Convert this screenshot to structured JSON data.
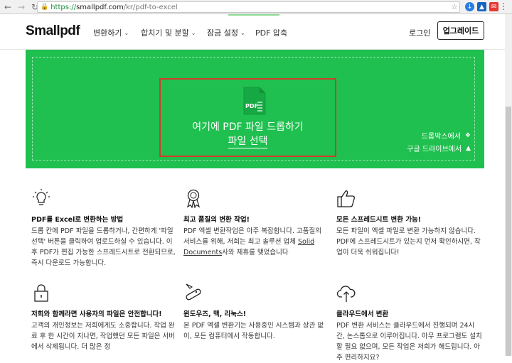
{
  "browser": {
    "url_scheme": "https://",
    "url_host": "smallpdf.com",
    "url_path": "/kr/pdf-to-excel"
  },
  "header": {
    "logo": "Smallpdf",
    "menu": [
      "변환하기",
      "합치기 및 분할",
      "잠금 설정",
      "PDF 압축"
    ],
    "login": "로그인",
    "upgrade": "업그레이드"
  },
  "dropzone": {
    "pdf_label": "PDF",
    "drop_text": "여기에 PDF 파일 드롭하기",
    "choose_file": "파일 선택",
    "dropbox": "드롭박스에서",
    "gdrive": "구글 드라이브에서"
  },
  "features": [
    {
      "icon": "lightbulb-icon",
      "title": "PDF를 Excel로 변환하는 방법",
      "body": "드롭 칸에 PDF 파일을 드롭하거나, 간편하게 '파일 선택' 버튼을 클릭하여 업로드하실 수 있습니다. 이후 PDF가 편집 가능한 스프레드시트로 전환되므로, 즉시 다운로드 가능합니다."
    },
    {
      "icon": "award-icon",
      "title": "최고 품질의 변환 작업!",
      "body_pre": "PDF 엑셀 변환작업은 아주 복잡합니다. 고품질의 서비스를 위해, 저희는 최고 솔루션 업체 ",
      "body_link": "Solid Documents",
      "body_post": "사와 제휴를 맺었습니다"
    },
    {
      "icon": "thumbs-up-icon",
      "title": "모든 스프레드시트 변환 가능!",
      "body": "모든 파일이 엑셀 파일로 변환 가능하지 않습니다. PDF에 스프레드시트가 있는지 먼저 확인하시면, 작업이 더욱 쉬워집니다!"
    },
    {
      "icon": "lock-icon",
      "title": "저희와 함께라면 사용자의 파일은 안전합니다!",
      "body": "고객의 개인정보는 저희에게도 소중합니다. 작업 완료 후 한 시간이 지나면, 작업했던 모든 파일은 서버에서 삭제됩니다. 더 많은 정"
    },
    {
      "icon": "swiss-knife-icon",
      "title": "윈도우즈, 맥, 리눅스!",
      "body": "본 PDF 엑셀 변환기는 사용중인 시스템과 상관 없이, 모든 컴퓨터에서 작동합니다."
    },
    {
      "icon": "cloud-upload-icon",
      "title": "클라우드에서 변환",
      "body": "PDF 변환 서비스는 클라우드에서 진행되며 24시간, 논스톱으로 이루어집니다. 아무 프로그램도 설치할 필요 없으며, 모든 작업은 저희가 해드립니다. 아주 편리하지요?"
    }
  ]
}
